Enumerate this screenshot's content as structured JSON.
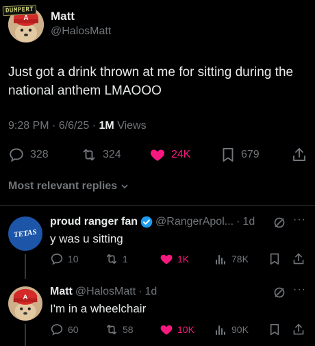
{
  "main_post": {
    "overlay_tag": "DUMPERT",
    "author_name": "Matt",
    "author_handle": "@HalosMatt",
    "text": "Just got a drink thrown at me for sitting during the national anthem LMAOOO",
    "time": "9:28 PM",
    "date": "6/6/25",
    "views_count": "1M",
    "views_label": "Views",
    "replies": "328",
    "reposts": "324",
    "likes": "24K",
    "bookmarks": "679"
  },
  "replies_sort_label": "Most relevant replies",
  "replies": [
    {
      "author_name": "proud ranger fan",
      "author_handle": "@RangerApol...",
      "time_ago": "1d",
      "text": "y was u sitting",
      "replies": "10",
      "reposts": "1",
      "likes": "1K",
      "views": "78K",
      "avatar_text": "TETAS"
    },
    {
      "author_name": "Matt",
      "author_handle": "@HalosMatt",
      "time_ago": "1d",
      "text": "I'm in a wheelchair",
      "replies": "60",
      "reposts": "58",
      "likes": "10K",
      "views": "90K"
    }
  ],
  "colors": {
    "background": "#000000",
    "text": "#e7e9ea",
    "muted": "#71767b",
    "like": "#f91880",
    "verified": "#1d9bf0",
    "divider": "#2f3336"
  }
}
